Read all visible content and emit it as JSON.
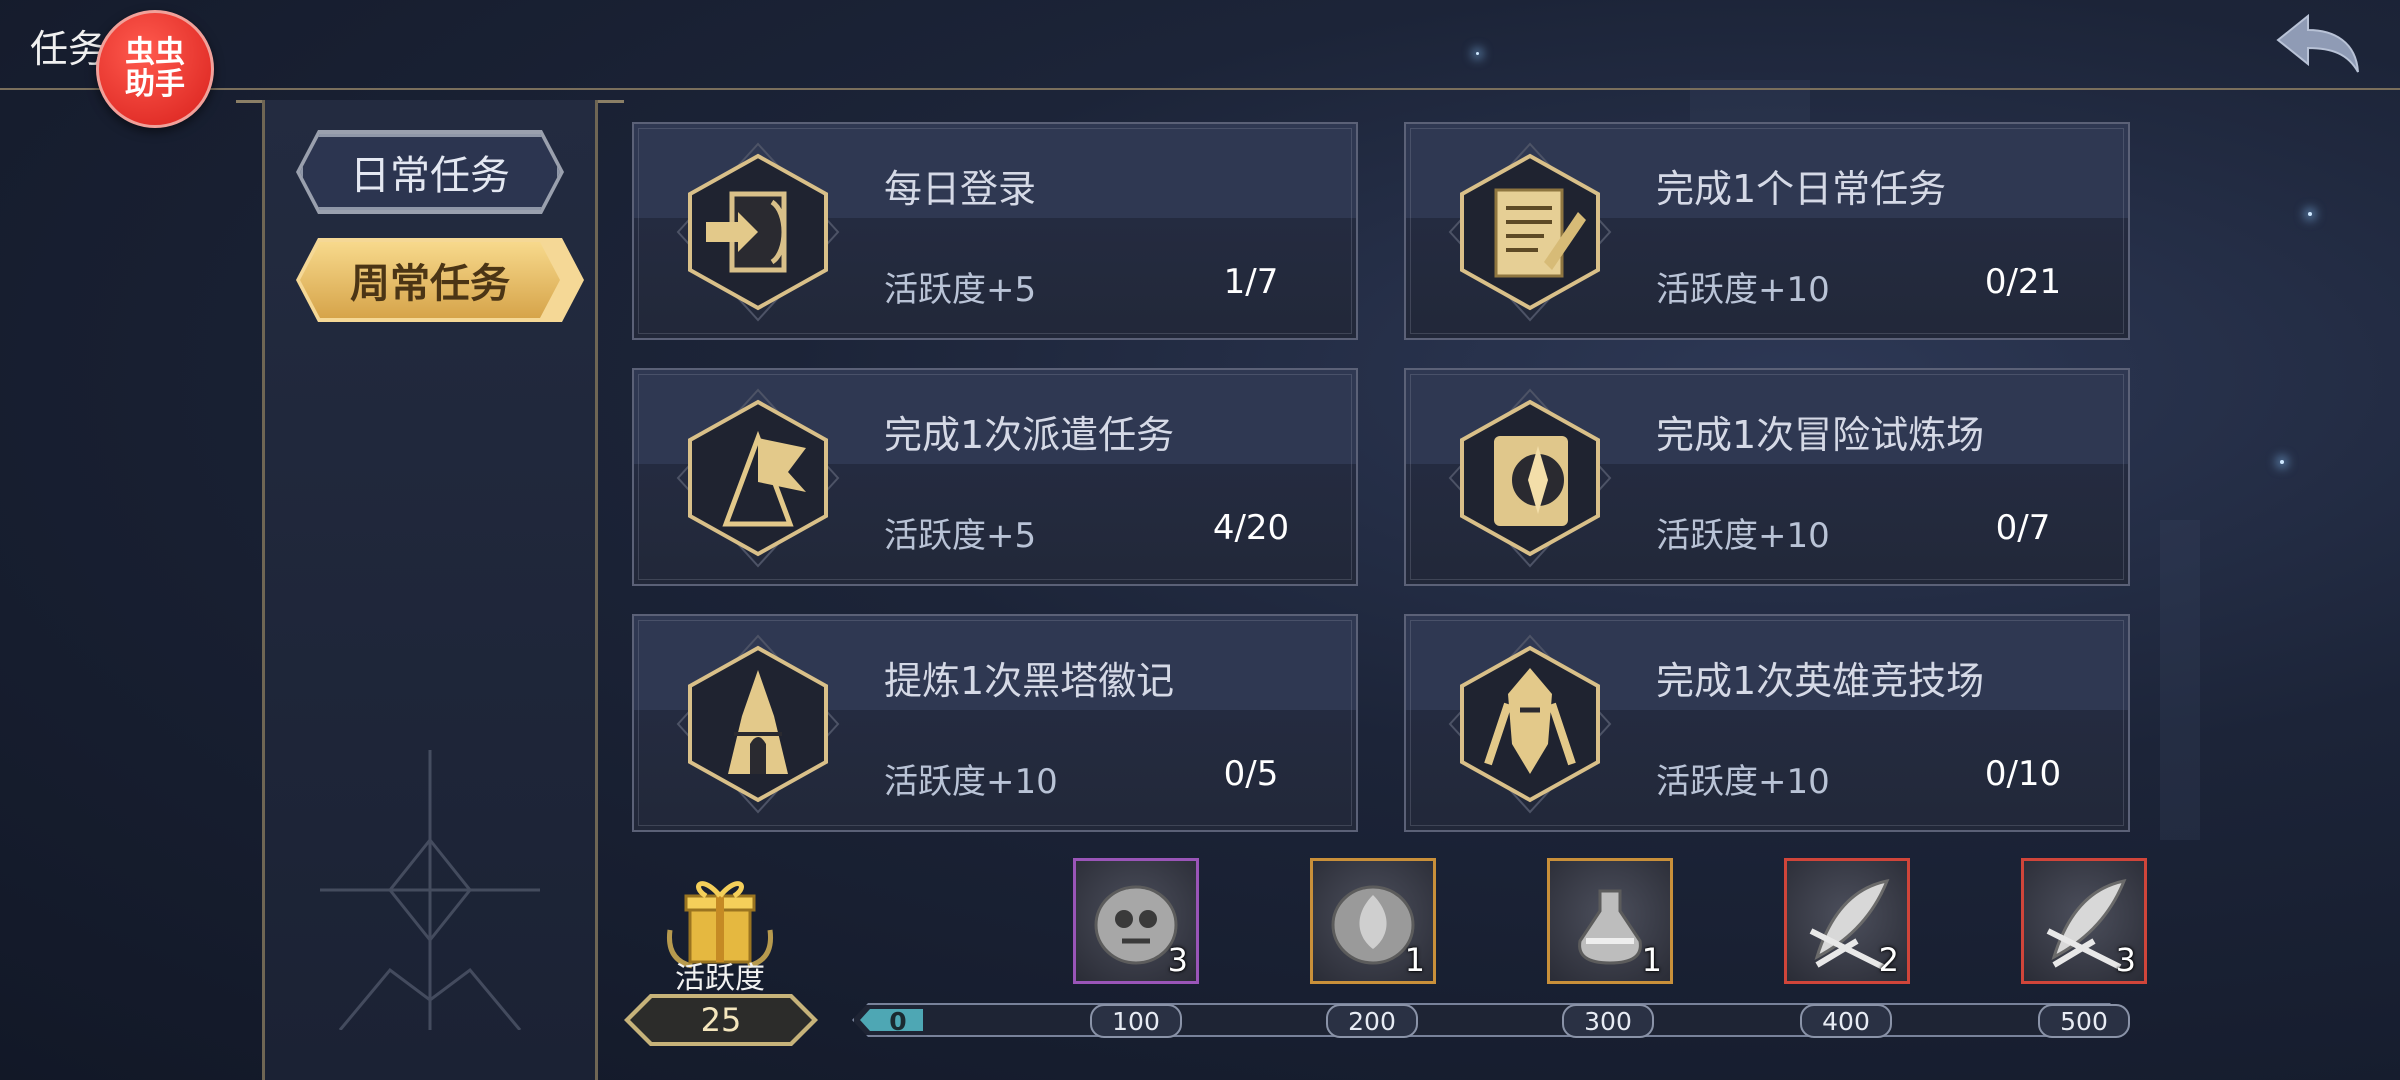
{
  "header": {
    "title": "任务",
    "helper_badge": [
      "虫虫",
      "助手"
    ],
    "back_icon": "back-arrow-icon"
  },
  "tabs": [
    {
      "label": "日常任务",
      "selected": false
    },
    {
      "label": "周常任务",
      "selected": true
    }
  ],
  "quests": [
    {
      "title": "每日登录",
      "reward": "活跃度+5",
      "progress": "1/7",
      "icon": "login-door-icon"
    },
    {
      "title": "完成1个日常任务",
      "reward": "活跃度+10",
      "progress": "0/21",
      "icon": "quest-scroll-icon"
    },
    {
      "title": "完成1次派遣任务",
      "reward": "活跃度+5",
      "progress": "4/20",
      "icon": "dispatch-flag-icon"
    },
    {
      "title": "完成1次冒险试炼场",
      "reward": "活跃度+10",
      "progress": "0/7",
      "icon": "trial-compass-icon"
    },
    {
      "title": "提炼1次黑塔徽记",
      "reward": "活跃度+10",
      "progress": "0/5",
      "icon": "black-tower-icon"
    },
    {
      "title": "完成1次英雄竞技场",
      "reward": "活跃度+10",
      "progress": "0/10",
      "icon": "arena-hero-icon"
    }
  ],
  "activity": {
    "label": "活跃度",
    "value": "25",
    "progress_fraction": 0.05,
    "milestones": [
      "0",
      "100",
      "200",
      "300",
      "400",
      "500"
    ]
  },
  "rewards": [
    {
      "icon": "skull-coin-icon",
      "count": "3",
      "frame_color": "#9a55b8"
    },
    {
      "icon": "flame-stone-icon",
      "count": "1",
      "frame_color": "#c9903a"
    },
    {
      "icon": "potion-bottle-icon",
      "count": "1",
      "frame_color": "#c9903a"
    },
    {
      "icon": "crossed-feather-icon",
      "count": "2",
      "frame_color": "#d0453a"
    },
    {
      "icon": "crossed-feather-icon",
      "count": "3",
      "frame_color": "#d0453a"
    }
  ]
}
